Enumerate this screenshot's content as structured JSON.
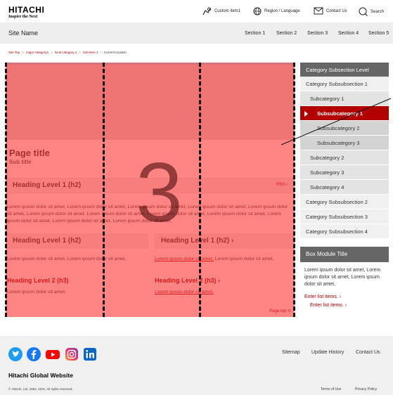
{
  "header": {
    "logo_main": "HITACHI",
    "logo_tagline": "Inspire the Next",
    "utility": [
      {
        "label": "Custom item1",
        "icon": "custom-item-icon"
      },
      {
        "label": "Region / Language",
        "icon": "globe-icon"
      },
      {
        "label": "Contact Us",
        "icon": "mail-icon"
      },
      {
        "label": "Search",
        "icon": "search-icon"
      }
    ],
    "site_name": "Site Name",
    "nav": [
      "Section 1",
      "Section 2",
      "Section 3",
      "Section 4",
      "Section 5"
    ]
  },
  "breadcrumb": {
    "links": [
      "Site Top",
      "major category1",
      "local category 1",
      "Sub item 1"
    ],
    "current": "Current location",
    "separator": ">"
  },
  "main": {
    "page_title": "Page title",
    "sub_title": "Sub title",
    "heading_top": "Heading Level 1 (h2)",
    "rss": "RSS",
    "lorem_paragraph": "Lorem ipsum dolor sit amet, Lorem ipsum dolor sit amet, Lorem ipsum dolor sit amet, Lorem ipsum dolor sit amet, Lorem ipsum dolor sit amet, Lorem ipsum dolor sit amet, Lorem ipsum dolor sit amet, Lorem ipsum dolor sit amet, Lorem ipsum dolor sit amet, Lorem ipsum dolor sit amet, Lorem ipsum dolor sit amet, Lorem ipsum dolor sit amet,",
    "left_col": {
      "heading": "Heading Level 1 (h2)",
      "text": "Lorem ipsum dolor sit amet, Lorem ipsum dolor sit amet,",
      "h3": "Heading Level 2 (h3)",
      "h3_text": "Lorem ipsum dolor sit amet,"
    },
    "right_col": {
      "heading": "Heading Level 1 (h2)",
      "link_text": "Lorem ipsum dolor sit amet,",
      "text_after_link": " Lorem ipsum dolor sit amet,",
      "h3": "Heading Level 2 (h3)",
      "h3_link": "Lorem ipsum dolor sit amet,"
    },
    "page_top": "Page top",
    "overlay_number": "3"
  },
  "sidebar": {
    "title": "Category Subsection Level",
    "items": [
      {
        "label": "Category Subsubsection 1",
        "level": 1
      },
      {
        "label": "Subcategory 1",
        "level": 2
      },
      {
        "label": "Subsubcategory 1",
        "level": 3,
        "active": true
      },
      {
        "label": "Subsubcategory 2",
        "level": 3
      },
      {
        "label": "Subsubcategory 3",
        "level": 3
      },
      {
        "label": "Subcategory 2",
        "level": 2
      },
      {
        "label": "Subcategory 3",
        "level": 2
      },
      {
        "label": "Subcategory 4",
        "level": 2
      },
      {
        "label": "Category Subsubsection 2",
        "level": 1
      },
      {
        "label": "Category Subsubsection 3",
        "level": 1
      },
      {
        "label": "Category Subsubsection 4",
        "level": 1
      }
    ],
    "box_title": "Box Module Title",
    "box_text": "Lorem ipsum dolor sit amet, Lorem ipsum dolor sit amet, Lorem ipsum dolor sit amet,",
    "box_list": [
      "Enter list items.",
      "Enter list items."
    ]
  },
  "footer": {
    "social": [
      "twitter-icon",
      "facebook-icon",
      "youtube-icon",
      "instagram-icon",
      "linkedin-icon"
    ],
    "links": [
      "Sitemap",
      "Update History",
      "Contact Us"
    ],
    "global": "Hitachi Global Website",
    "copyright": "© Hitachi, Ltd. 1994, 2021. All rights reserved.",
    "legal": [
      "Terms of Use",
      "Privacy Policy"
    ]
  },
  "colors": {
    "accent": "#b00000",
    "overlay": "#ff2d2d",
    "sidebar_header": "#666666",
    "hero_top": "#9bd0ea"
  }
}
